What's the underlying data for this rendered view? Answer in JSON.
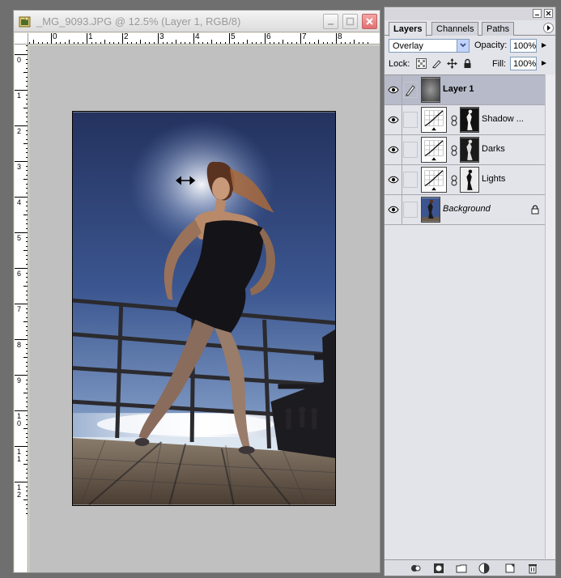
{
  "document": {
    "title": "_MG_9093.JPG @ 12.5% (Layer 1, RGB/8)",
    "ruler_h_labels": [
      "1",
      "0",
      "1",
      "2",
      "3",
      "4",
      "5",
      "6",
      "7",
      "8"
    ],
    "ruler_v_labels": [
      "1",
      "0",
      "1",
      "2",
      "3",
      "4",
      "5",
      "6",
      "7",
      "8",
      "9",
      "1\n0",
      "1\n1",
      "1\n2"
    ]
  },
  "layers_panel": {
    "tabs": [
      "Layers",
      "Channels",
      "Paths"
    ],
    "blend_mode": "Overlay",
    "opacity_label": "Opacity:",
    "opacity_value": "100%",
    "lock_label": "Lock:",
    "fill_label": "Fill:",
    "fill_value": "100%",
    "layers": [
      {
        "name": "Layer 1",
        "selected": true
      },
      {
        "name": "Shadow ...",
        "selected": false
      },
      {
        "name": "Darks",
        "selected": false
      },
      {
        "name": "Lights",
        "selected": false
      },
      {
        "name": "Background",
        "selected": false
      }
    ]
  },
  "colors": {
    "accent_selected": "#b7bac8",
    "close_button": "#e07070",
    "canvas_bg": "#c0c0c0"
  }
}
